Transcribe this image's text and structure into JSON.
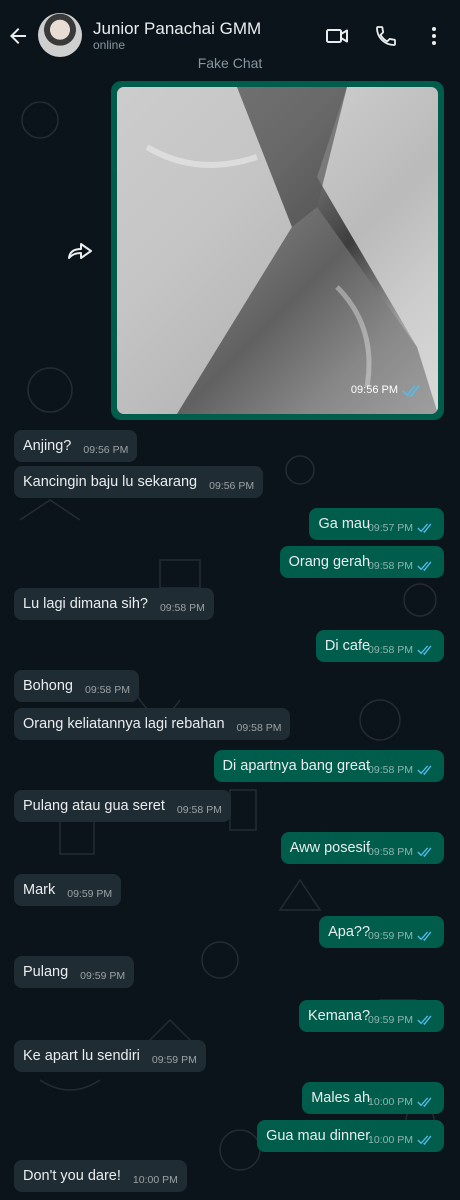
{
  "header": {
    "title": "Junior Panachai GMM",
    "status": "online",
    "watermark": "Fake Chat"
  },
  "colors": {
    "background": "#0b141a",
    "incoming_bubble": "#202c33",
    "outgoing_bubble": "#005c4b",
    "read_ticks": "#53bdeb"
  },
  "icons": {
    "back": "back-arrow-icon",
    "video": "video-call-icon",
    "call": "phone-icon",
    "menu": "more-vert-icon",
    "forward": "forward-icon",
    "read": "double-check-icon"
  },
  "image_message": {
    "time": "09:56 PM"
  },
  "messages": [
    {
      "dir": "in",
      "text": "Anjing?",
      "time": "09:56 PM"
    },
    {
      "dir": "in",
      "text": "Kancingin baju lu sekarang",
      "time": "09:56 PM"
    },
    {
      "dir": "out",
      "text": "Ga mau",
      "time": "09:57 PM"
    },
    {
      "dir": "out",
      "text": "Orang gerah",
      "time": "09:58 PM"
    },
    {
      "dir": "in",
      "text": "Lu lagi dimana sih?",
      "time": "09:58 PM"
    },
    {
      "dir": "out",
      "text": "Di cafe",
      "time": "09:58 PM"
    },
    {
      "dir": "in",
      "text": "Bohong",
      "time": "09:58 PM"
    },
    {
      "dir": "in",
      "text": "Orang keliatannya lagi rebahan",
      "time": "09:58 PM"
    },
    {
      "dir": "out",
      "text": "Di apartnya bang great",
      "time": "09:58 PM"
    },
    {
      "dir": "in",
      "text": "Pulang atau gua seret",
      "time": "09:58 PM"
    },
    {
      "dir": "out",
      "text": "Aww posesif",
      "time": "09:58 PM"
    },
    {
      "dir": "in",
      "text": "Mark",
      "time": "09:59 PM"
    },
    {
      "dir": "out",
      "text": "Apa??",
      "time": "09:59 PM"
    },
    {
      "dir": "in",
      "text": "Pulang",
      "time": "09:59 PM"
    },
    {
      "dir": "out",
      "text": "Kemana?",
      "time": "09:59 PM"
    },
    {
      "dir": "in",
      "text": "Ke apart lu sendiri",
      "time": "09:59 PM"
    },
    {
      "dir": "out",
      "text": "Males ah",
      "time": "10:00 PM"
    },
    {
      "dir": "out",
      "text": "Gua mau dinner",
      "time": "10:00 PM"
    },
    {
      "dir": "in",
      "text": "Don't you dare!",
      "time": "10:00 PM"
    }
  ]
}
